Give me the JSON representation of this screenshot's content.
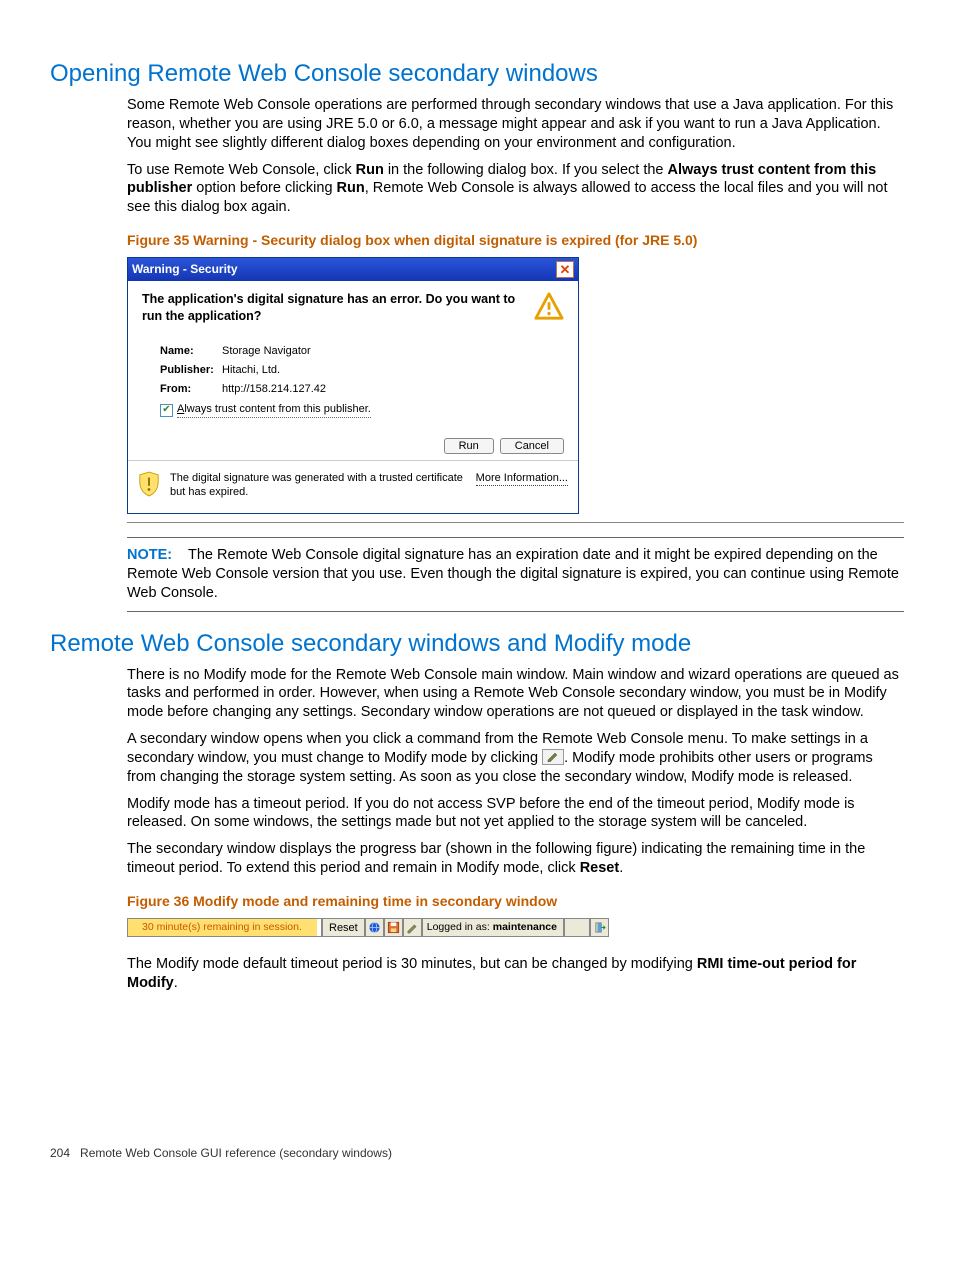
{
  "section1": {
    "heading": "Opening Remote Web Console secondary windows",
    "p1": "Some Remote Web Console operations are performed through secondary windows that use a Java application. For this reason, whether you are using JRE 5.0 or 6.0, a message might appear and ask if you want to run a Java Application. You might see slightly different dialog boxes depending on your environment and configuration.",
    "p2a": "To use Remote Web Console, click ",
    "p2_run": "Run",
    "p2b": " in the following dialog box. If you select the ",
    "p2_always": "Always trust content from this publisher",
    "p2c": " option before clicking ",
    "p2_run2": "Run",
    "p2d": ", Remote Web Console is always allowed to access the local files and you will not see this dialog box again.",
    "fig35_caption": "Figure 35 Warning - Security dialog box when digital signature is expired (for JRE 5.0)"
  },
  "dialog35": {
    "title": "Warning - Security",
    "message": "The application's digital signature has an error.  Do you want to run the application?",
    "name_lbl": "Name:",
    "name_val": "Storage Navigator",
    "pub_lbl": "Publisher:",
    "pub_val": "Hitachi, Ltd.",
    "from_lbl": "From:",
    "from_val": "http://158.214.127.42",
    "checkbox_u": "A",
    "checkbox": "lways trust content from this publisher.",
    "run_btn": "Run",
    "cancel_btn": "Cancel",
    "foot_text": "The digital signature was generated with a trusted certificate but has expired.",
    "more_info": "More Information..."
  },
  "note1": {
    "label": "NOTE:",
    "text": "The Remote Web Console digital signature has an expiration date and it might be expired depending on the Remote Web Console version that you use. Even though the digital signature is expired, you can continue using Remote Web Console."
  },
  "section2": {
    "heading": "Remote Web Console secondary windows and Modify mode",
    "p1": "There is no Modify mode for the Remote Web Console main window. Main window and wizard operations are queued as tasks and performed in order. However, when using a Remote Web Console secondary window, you must be in Modify mode before changing any settings. Secondary window operations are not queued or displayed in the task window.",
    "p2a": "A secondary window opens when you click a command from the Remote Web Console menu. To make settings in a secondary window, you must change to Modify mode by clicking ",
    "p2b": ". Modify mode prohibits other users or programs from changing the storage system setting. As soon as you close the secondary window, Modify mode is released.",
    "p3": "Modify mode has a timeout period. If you do not access SVP before the end of the timeout period, Modify mode is released. On some windows, the settings made but not yet applied to the storage system will be canceled.",
    "p4a": "The secondary window displays the progress bar (shown in the following figure) indicating the remaining time in the timeout period. To extend this period and remain in Modify mode, click ",
    "p4_reset": "Reset",
    "p4b": ".",
    "fig36_caption": "Figure 36  Modify mode and remaining time in secondary window",
    "p5a": "The Modify mode default timeout period is 30 minutes, but can be changed by modifying ",
    "p5_bold": "RMI time-out period for Modify",
    "p5b": "."
  },
  "toolbar36": {
    "progress_text": "30 minute(s) remaining in session.",
    "reset_btn": "Reset",
    "login_label": "Logged in as:",
    "login_user": "maintenance"
  },
  "footer": {
    "page": "204",
    "text": "Remote Web Console GUI reference (secondary windows)"
  }
}
